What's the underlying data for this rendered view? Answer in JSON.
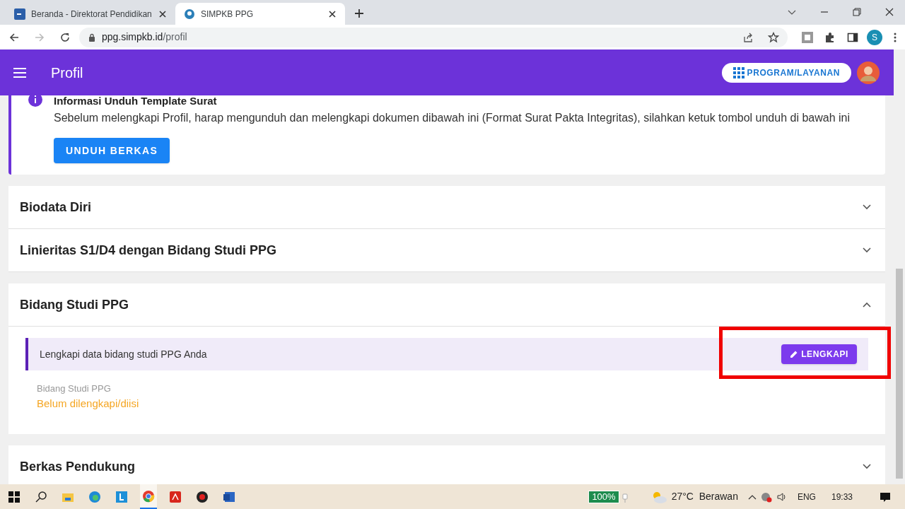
{
  "browser": {
    "tabs": [
      {
        "title": "Beranda - Direktorat Pendidikan",
        "selected": false
      },
      {
        "title": "SIMPKB PPG",
        "selected": true
      }
    ],
    "url_host": "ppg.simpkb.id",
    "url_path": "/profil",
    "profile_initial": "S"
  },
  "app_bar": {
    "title": "Profil",
    "program_button": "PROGRAM/LAYANAN"
  },
  "info": {
    "title": "Informasi Unduh Template Surat",
    "text": "Sebelum melengkapi Profil, harap mengunduh dan melengkapi dokumen dibawah ini (Format Surat Pakta Integritas), silahkan ketuk tombol unduh di bawah ini",
    "button": "UNDUH BERKAS"
  },
  "sections": [
    {
      "title": "Biodata Diri",
      "expanded": false
    },
    {
      "title": "Linieritas S1/D4 dengan Bidang Studi PPG",
      "expanded": false
    },
    {
      "title": "Bidang Studi PPG",
      "expanded": true,
      "notice": "Lengkapi data bidang studi PPG Anda",
      "action": "LENGKAPI",
      "field_label": "Bidang Studi PPG",
      "field_value": "Belum dilengkapi/diisi"
    },
    {
      "title": "Berkas Pendukung",
      "expanded": false
    }
  ],
  "taskbar": {
    "battery": "100%",
    "weather": "27°C  Berawan",
    "language": "ENG",
    "time": "19:33"
  }
}
